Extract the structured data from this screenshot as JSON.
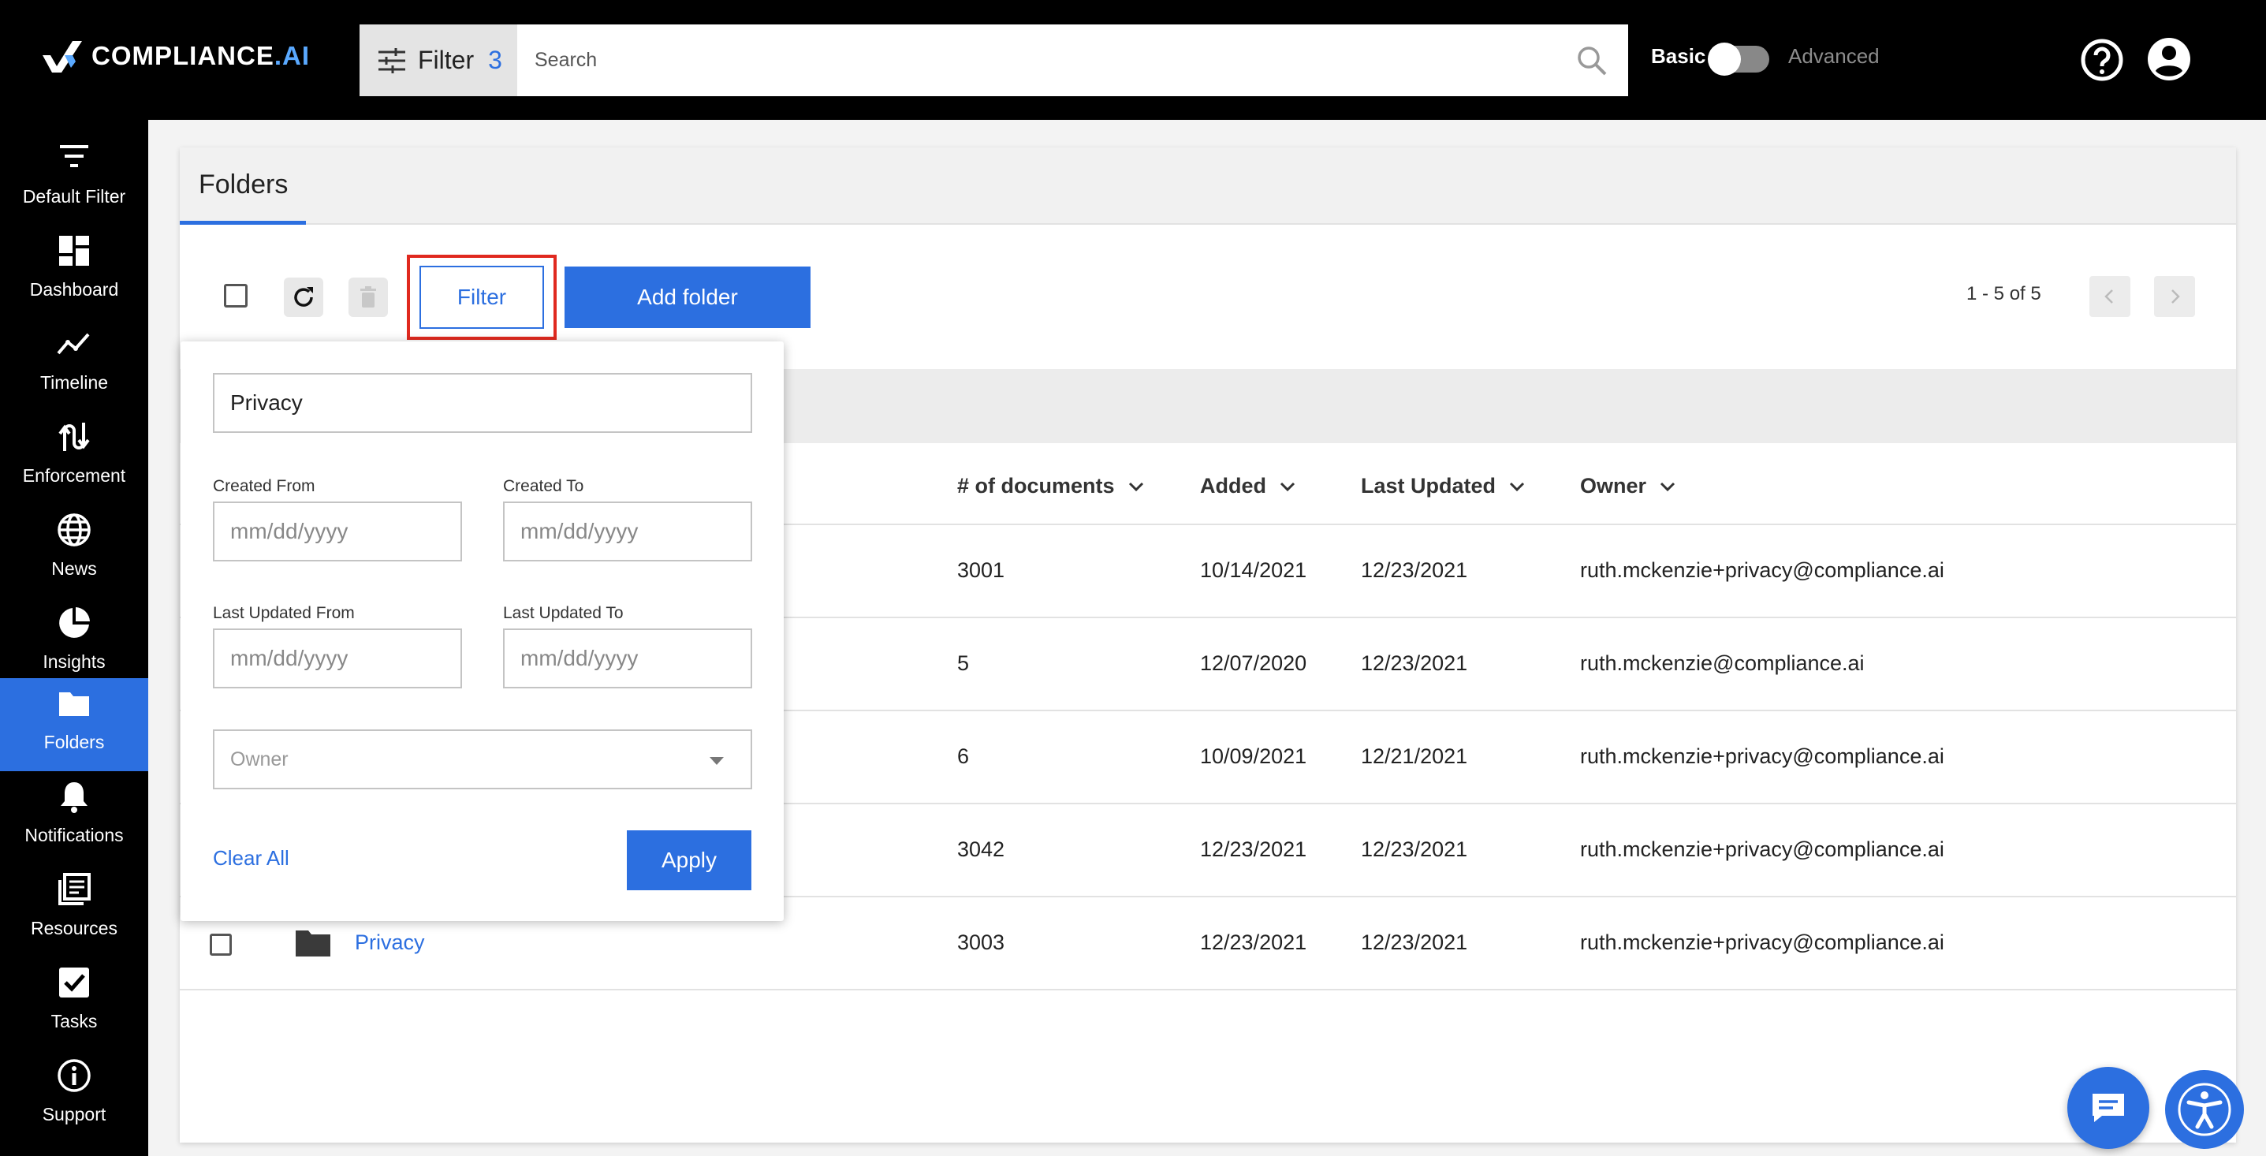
{
  "brand": {
    "name_main": "COMPLIANCE",
    "name_suffix": ".AI"
  },
  "header": {
    "filter_label": "Filter",
    "filter_count": "3",
    "search_placeholder": "Search",
    "mode_basic": "Basic",
    "mode_advanced": "Advanced",
    "mode_is_advanced": false
  },
  "sidebar": {
    "items": [
      {
        "label": "Default Filter",
        "icon": "filter-lines-icon"
      },
      {
        "label": "Dashboard",
        "icon": "dashboard-icon"
      },
      {
        "label": "Timeline",
        "icon": "timeline-icon"
      },
      {
        "label": "Enforcement",
        "icon": "enforcement-icon"
      },
      {
        "label": "News",
        "icon": "globe-icon"
      },
      {
        "label": "Insights",
        "icon": "pie-chart-icon"
      },
      {
        "label": "Folders",
        "icon": "folder-icon",
        "active": true
      },
      {
        "label": "Notifications",
        "icon": "bell-icon"
      },
      {
        "label": "Resources",
        "icon": "library-icon"
      },
      {
        "label": "Tasks",
        "icon": "checkbox-icon"
      },
      {
        "label": "Support",
        "icon": "info-icon"
      }
    ]
  },
  "main": {
    "tab_label": "Folders",
    "filter_button": "Filter",
    "add_folder_button": "Add folder",
    "pagination": "1 - 5 of 5",
    "columns": {
      "documents": "# of documents",
      "added": "Added",
      "last_updated": "Last Updated",
      "owner": "Owner"
    },
    "rows": [
      {
        "name": "",
        "documents": "3001",
        "added": "10/14/2021",
        "last_updated": "12/23/2021",
        "owner": "ruth.mckenzie+privacy@compliance.ai"
      },
      {
        "name": "",
        "documents": "5",
        "added": "12/07/2020",
        "last_updated": "12/23/2021",
        "owner": "ruth.mckenzie@compliance.ai"
      },
      {
        "name": "",
        "documents": "6",
        "added": "10/09/2021",
        "last_updated": "12/21/2021",
        "owner": "ruth.mckenzie+privacy@compliance.ai"
      },
      {
        "name": "",
        "documents": "3042",
        "added": "12/23/2021",
        "last_updated": "12/23/2021",
        "owner": "ruth.mckenzie+privacy@compliance.ai"
      },
      {
        "name": "Privacy",
        "documents": "3003",
        "added": "12/23/2021",
        "last_updated": "12/23/2021",
        "owner": "ruth.mckenzie+privacy@compliance.ai"
      }
    ]
  },
  "filter_panel": {
    "name_value": "Privacy",
    "created_from_label": "Created From",
    "created_to_label": "Created To",
    "last_updated_from_label": "Last Updated From",
    "last_updated_to_label": "Last Updated To",
    "date_placeholder": "mm/dd/yyyy",
    "owner_placeholder": "Owner",
    "clear_all": "Clear All",
    "apply": "Apply"
  },
  "colors": {
    "accent": "#2c6fe0",
    "highlight_outline": "#e0291f",
    "topbar": "#000000"
  }
}
